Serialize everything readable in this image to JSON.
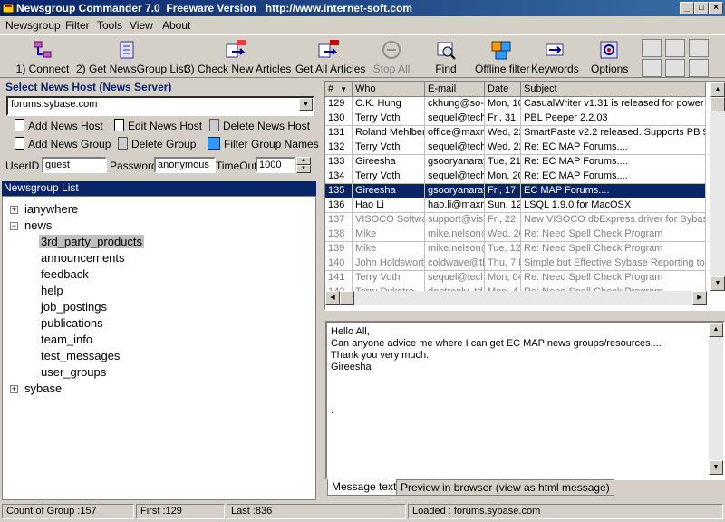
{
  "window": {
    "title": "Newsgroup Commander 7.0  Freeware Version   http://www.internet-soft.com",
    "minimize": "_",
    "maximize": "□",
    "close": "×"
  },
  "menu": [
    "Newsgroup",
    "Filter",
    "Tools",
    "View",
    "About"
  ],
  "toolbar": [
    {
      "label": "1) Connect",
      "icon": "connect-icon"
    },
    {
      "label": "2) Get NewsGroup List",
      "icon": "get-list-icon"
    },
    {
      "label": "3) Check New Articles",
      "icon": "new-articles-icon"
    },
    {
      "label": "Get All Articles",
      "icon": "all-articles-icon"
    },
    {
      "label": "Stop All",
      "icon": "stop-icon",
      "disabled": true
    },
    {
      "label": "Find",
      "icon": "find-icon"
    },
    {
      "label": "Offline filter",
      "icon": "filter-icon"
    },
    {
      "label": "Keywords",
      "icon": "keywords-icon"
    },
    {
      "label": "Options",
      "icon": "options-icon"
    }
  ],
  "host": {
    "title": "Select News Host (News Server)",
    "server": "forums.sybase.com",
    "add_host": "Add News Host",
    "edit_host": "Edit News Host",
    "delete_host": "Delete News Host",
    "add_group": "Add News Group",
    "delete_group": "Delete Group",
    "filter_names": "Filter Group Names",
    "userid_label": "UserID",
    "userid": "guest",
    "password_label": "Password",
    "password": "anonymous",
    "timeout_label": "TimeOut",
    "timeout": "1000"
  },
  "newsgroup_list": {
    "header": "Newsgroup List",
    "items": [
      {
        "label": "ianywhere",
        "level": 0,
        "expander": "+"
      },
      {
        "label": "news",
        "level": 0,
        "expander": "−"
      },
      {
        "label": "3rd_party_products",
        "level": 1,
        "selected": true
      },
      {
        "label": "announcements",
        "level": 1
      },
      {
        "label": "feedback",
        "level": 1
      },
      {
        "label": "help",
        "level": 1
      },
      {
        "label": "job_postings",
        "level": 1
      },
      {
        "label": "publications",
        "level": 1
      },
      {
        "label": "team_info",
        "level": 1
      },
      {
        "label": "test_messages",
        "level": 1
      },
      {
        "label": "user_groups",
        "level": 1
      },
      {
        "label": "sybase",
        "level": 0,
        "expander": "+"
      }
    ]
  },
  "articles": {
    "columns": [
      "#",
      "Who",
      "E-mail",
      "Date",
      "Subject"
    ],
    "sort_indicator": "▼",
    "rows": [
      {
        "num": "129",
        "who": "C.K. Hung",
        "email": "ckhung@so-n",
        "date": "Mon, 10",
        "subject": "CasualWriter v1.31 is released for power"
      },
      {
        "num": "130",
        "who": "Terry Voth",
        "email": "sequel@techn",
        "date": "Fri, 31",
        "subject": "PBL Peeper 2.2.03"
      },
      {
        "num": "131",
        "who": "Roland Mehlberg",
        "email": "office@maxm",
        "date": "Wed, 22",
        "subject": "SmartPaste v2.2 released. Supports PB 9"
      },
      {
        "num": "132",
        "who": "Terry Voth",
        "email": "sequel@techn",
        "date": "Wed, 22",
        "subject": "Re: EC MAP Forums...."
      },
      {
        "num": "133",
        "who": "Gireesha",
        "email": "gsooryanaray",
        "date": "Tue, 21",
        "subject": "Re: EC MAP Forums...."
      },
      {
        "num": "134",
        "who": "Terry Voth",
        "email": "sequel@techn",
        "date": "Mon, 20",
        "subject": "Re: EC MAP Forums...."
      },
      {
        "num": "135",
        "who": "Gireesha",
        "email": "gsooryanaray",
        "date": "Fri, 17",
        "subject": "EC MAP Forums....",
        "selected": true
      },
      {
        "num": "136",
        "who": "Hao Li",
        "email": "hao.li@maxm",
        "date": "Sun, 12",
        "subject": "LSQL 1.9.0 for MacOSX"
      },
      {
        "num": "137",
        "who": "VISOCO Software",
        "email": "support@visc",
        "date": "Fri, 22",
        "subject": "New VISOCO dbExpress driver for Sybas",
        "dim": true
      },
      {
        "num": "138",
        "who": "Mike",
        "email": "mike.nelson@",
        "date": "Wed, 20",
        "subject": "Re: Need Spell Check Program",
        "dim": true
      },
      {
        "num": "139",
        "who": "Mike",
        "email": "mike.nelson@",
        "date": "Tue, 12",
        "subject": "Re: Need Spell Check Program",
        "dim": true
      },
      {
        "num": "140",
        "who": "John Holdsworth",
        "email": "coldwave@th",
        "date": "Thu, 7 N",
        "subject": "Simple but Effective Sybase Reporting to",
        "dim": true
      },
      {
        "num": "141",
        "who": "Terry Voth",
        "email": "sequel@techn",
        "date": "Mon, 04",
        "subject": "Re: Need Spell Check Program",
        "dim": true
      },
      {
        "num": "142",
        "who": "Terry Dykstra",
        "email": "dontreply_td",
        "date": "Mon, 4",
        "subject": "Re: Need Spell Check Program",
        "dim": true
      }
    ]
  },
  "message": {
    "lines": [
      "Hello All,",
      "Can anyone advice me where I can get EC MAP news groups/resources....",
      "Thank you very much.",
      "Gireesha",
      "",
      "."
    ],
    "tabs": [
      "Message text",
      "Preview in browser (view as html message)"
    ]
  },
  "status": {
    "count": "Count of Group :157",
    "first": "First :129",
    "last": "Last :836",
    "loaded": "Loaded : forums.sybase.com"
  }
}
